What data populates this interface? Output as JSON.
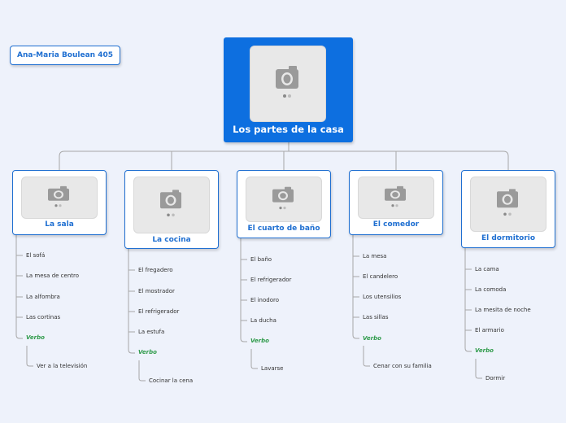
{
  "author": "Ana-Maria Boulean 405",
  "root": {
    "title": "Los partes de la casa"
  },
  "rooms": [
    {
      "title": "La sala",
      "items": [
        "El sofá",
        "La mesa de centro",
        "La alfombra",
        "Las cortinas"
      ],
      "verb_label": "Verbo",
      "verb": "Ver a la televisión"
    },
    {
      "title": "La cocina",
      "items": [
        "El fregadero",
        "El mostrador",
        "El refrigerador",
        "La estufa"
      ],
      "verb_label": "Verbo",
      "verb": "Cocinar la cena"
    },
    {
      "title": "El cuarto de baño",
      "items": [
        "El baño",
        "El refrigerador",
        "El inodoro",
        "La ducha"
      ],
      "verb_label": "Verbo",
      "verb": "Lavarse"
    },
    {
      "title": "El comedor",
      "items": [
        "La mesa",
        "El candelero",
        "Los utensilios",
        "Las sillas"
      ],
      "verb_label": "Verbo",
      "verb": "Cenar con su familia"
    },
    {
      "title": "El dormitorio",
      "items": [
        "La cama",
        "La comoda",
        "La mesita de noche",
        "El armario"
      ],
      "verb_label": "Verbo",
      "verb": "Dormir"
    }
  ],
  "colors": {
    "accent": "#1f6fd1",
    "root_bg": "#0d6fe0",
    "verb": "#2e9a4a",
    "line": "#a7a7a7"
  }
}
